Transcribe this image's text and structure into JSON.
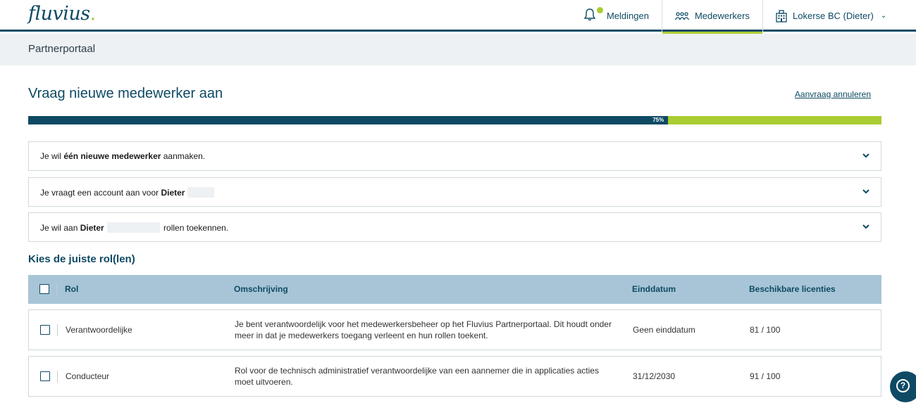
{
  "header": {
    "logo_text": "fluvius",
    "logo_dot": ".",
    "nav": {
      "notifications_label": "Meldingen",
      "notifications_icon": "bell-icon",
      "employees_label": "Medewerkers",
      "employees_icon": "people-icon",
      "account_label": "Lokerse BC (Dieter)",
      "account_icon": "building-icon"
    }
  },
  "subheader": {
    "title": "Partnerportaal"
  },
  "page": {
    "title": "Vraag nieuwe medewerker aan",
    "cancel_link": "Aanvraag annuleren"
  },
  "progress": {
    "value": 75,
    "label": "75%"
  },
  "summary": [
    {
      "pre": "Je wil ",
      "bold": "één nieuwe medewerker",
      "post": " aanmaken."
    },
    {
      "pre": "Je vraagt een account aan voor ",
      "bold": "Dieter",
      "post": ""
    },
    {
      "pre": "Je wil aan ",
      "bold": "Dieter",
      "post": " rollen toekennen."
    }
  ],
  "roles_section": {
    "title": "Kies de juiste rol(len)",
    "columns": {
      "role": "Rol",
      "description": "Omschrijving",
      "end_date": "Einddatum",
      "licenses": "Beschikbare licenties"
    },
    "rows": [
      {
        "role": "Verantwoordelijke",
        "description": "Je bent verantwoordelijk voor het medewerkersbeheer op het Fluvius Partnerportaal. Dit houdt onder meer in dat je medewerkers toegang verleent en hun rollen toekent.",
        "end_date": "Geen einddatum",
        "licenses": "81 / 100"
      },
      {
        "role": "Conducteur",
        "description": "Rol voor de technisch administratief verantwoordelijke van een aannemer die in applicaties acties moet uitvoeren.",
        "end_date": "31/12/2030",
        "licenses": "91 / 100"
      }
    ]
  },
  "colors": {
    "primary": "#0e4a64",
    "accent": "#a9cd32",
    "subbar_bg": "#edf1f4",
    "table_header_bg": "#a7c5d6"
  }
}
